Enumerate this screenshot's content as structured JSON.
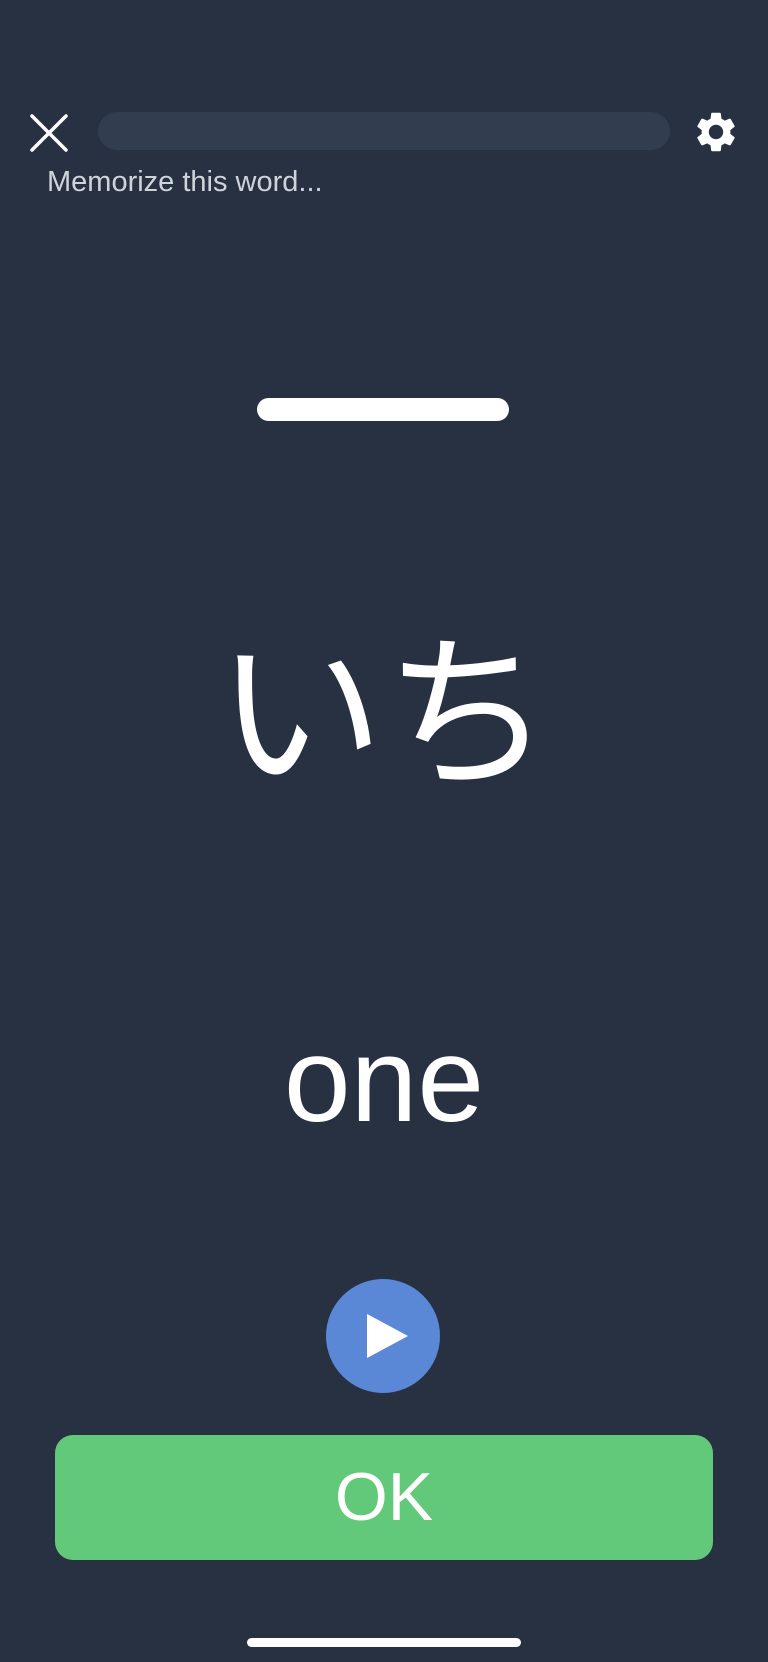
{
  "header": {
    "close_icon": "close-icon",
    "settings_icon": "gear-icon",
    "progress": 0
  },
  "instruction": "Memorize this word...",
  "card": {
    "kanji": "一",
    "reading": "いち",
    "meaning": "one",
    "play_icon": "play-icon"
  },
  "actions": {
    "ok_label": "OK"
  },
  "colors": {
    "background": "#283142",
    "track": "#323e50",
    "accent_blue": "#5a88d6",
    "ok_green": "#63c97a",
    "text": "#ffffff"
  }
}
